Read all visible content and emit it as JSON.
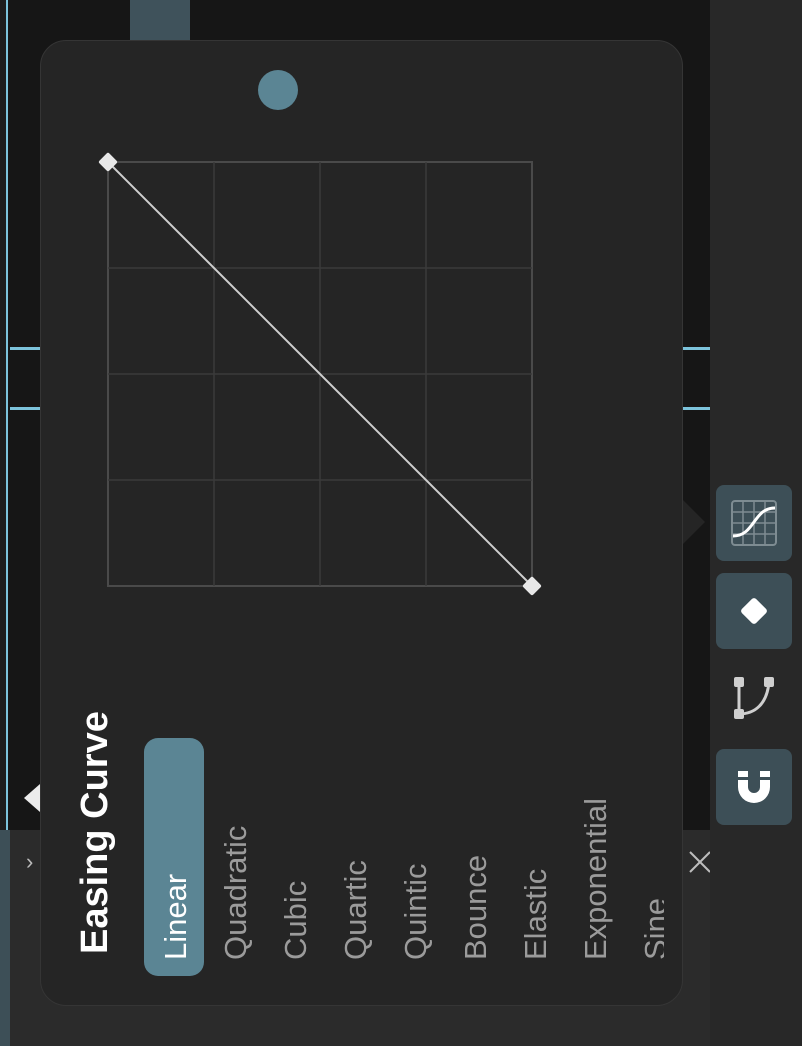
{
  "popover": {
    "title": "Easing Curve",
    "curve_graph": {
      "start_point": [
        0,
        0
      ],
      "end_point": [
        1,
        1
      ],
      "grid_divisions": 4
    },
    "options": [
      {
        "label": "Linear",
        "selected": true
      },
      {
        "label": "Quadratic",
        "selected": false
      },
      {
        "label": "Cubic",
        "selected": false
      },
      {
        "label": "Quartic",
        "selected": false
      },
      {
        "label": "Quintic",
        "selected": false
      },
      {
        "label": "Bounce",
        "selected": false
      },
      {
        "label": "Elastic",
        "selected": false
      },
      {
        "label": "Exponential",
        "selected": false
      },
      {
        "label": "Sine",
        "selected": false
      }
    ]
  },
  "toolbar": {
    "tools": [
      {
        "id": "easing-curve",
        "icon": "easing-curve-icon",
        "active": true
      },
      {
        "id": "keyframe",
        "icon": "keyframe-diamond-icon",
        "active": true
      },
      {
        "id": "path",
        "icon": "bezier-path-icon",
        "active": false
      },
      {
        "id": "snap",
        "icon": "magnet-icon",
        "active": true
      }
    ]
  },
  "colors": {
    "accent": "#5b8594",
    "guide": "#7cc3db",
    "popover_bg": "#252525",
    "active_tool_bg": "#3d4f57"
  }
}
